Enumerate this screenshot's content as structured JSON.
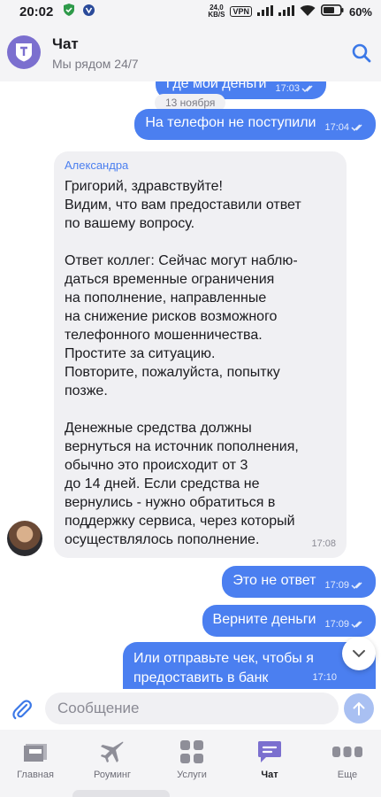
{
  "statusbar": {
    "time": "20:02",
    "net_speed_value": "24,0",
    "net_speed_unit": "KB/S",
    "vpn": "VPN",
    "battery": "60%"
  },
  "header": {
    "title": "Чат",
    "subtitle": "Мы рядом 24/7"
  },
  "messages": {
    "top_partial": {
      "text": "Где мои деньги",
      "time": "17:03"
    },
    "date_divider": "13 ноября",
    "out1": {
      "text": "На телефон не поступили",
      "time": "17:04"
    },
    "incoming": {
      "sender": "Александра",
      "lines": {
        "l1": "Григорий, здравствуйте!",
        "l2": "Видим, что вам предоставили ответ",
        "l3": "по вашему вопросу.",
        "l4": "Ответ коллег: Сейчас могут наблю-",
        "l5": "даться временные ограничения",
        "l6": "на пополнение, направленные",
        "l7": "на снижение рисков возможного",
        "l8": "телефонного мошенничества.",
        "l9": "Простите за ситуацию.",
        "l10": "Повторите, пожалуйста, попытку",
        "l11": "позже.",
        "l12": "Денежные средства должны",
        "l13": "вернуться на источник пополнения,",
        "l14": "обычно это происходит от 3",
        "l15": "до 14 дней. Если средства не",
        "l16": "вернулись - нужно обратиться в",
        "l17": "поддержку сервиса, через который",
        "l18": "осуществлялось пополнение."
      },
      "time": "17:08"
    },
    "out2": {
      "text": "Это не ответ",
      "time": "17:09"
    },
    "out3": {
      "text": "Верните деньги",
      "time": "17:09"
    },
    "out4": {
      "line1": "Или отправьте чек, чтобы я",
      "line2": "предоставить в банк",
      "time": "17:10"
    }
  },
  "input": {
    "placeholder": "Сообщение"
  },
  "tabs": {
    "home": "Главная",
    "roaming": "Роуминг",
    "services": "Услуги",
    "chat": "Чат",
    "more": "Еще"
  },
  "colors": {
    "accent": "#4b7ff0",
    "brand_logo": "#7b6fcf",
    "incoming_bubble": "#f0f0f3"
  },
  "icons": {
    "search": "search-icon",
    "attach": "paperclip-icon",
    "send": "arrow-up-icon",
    "scroll_down": "chevron-down-icon"
  }
}
